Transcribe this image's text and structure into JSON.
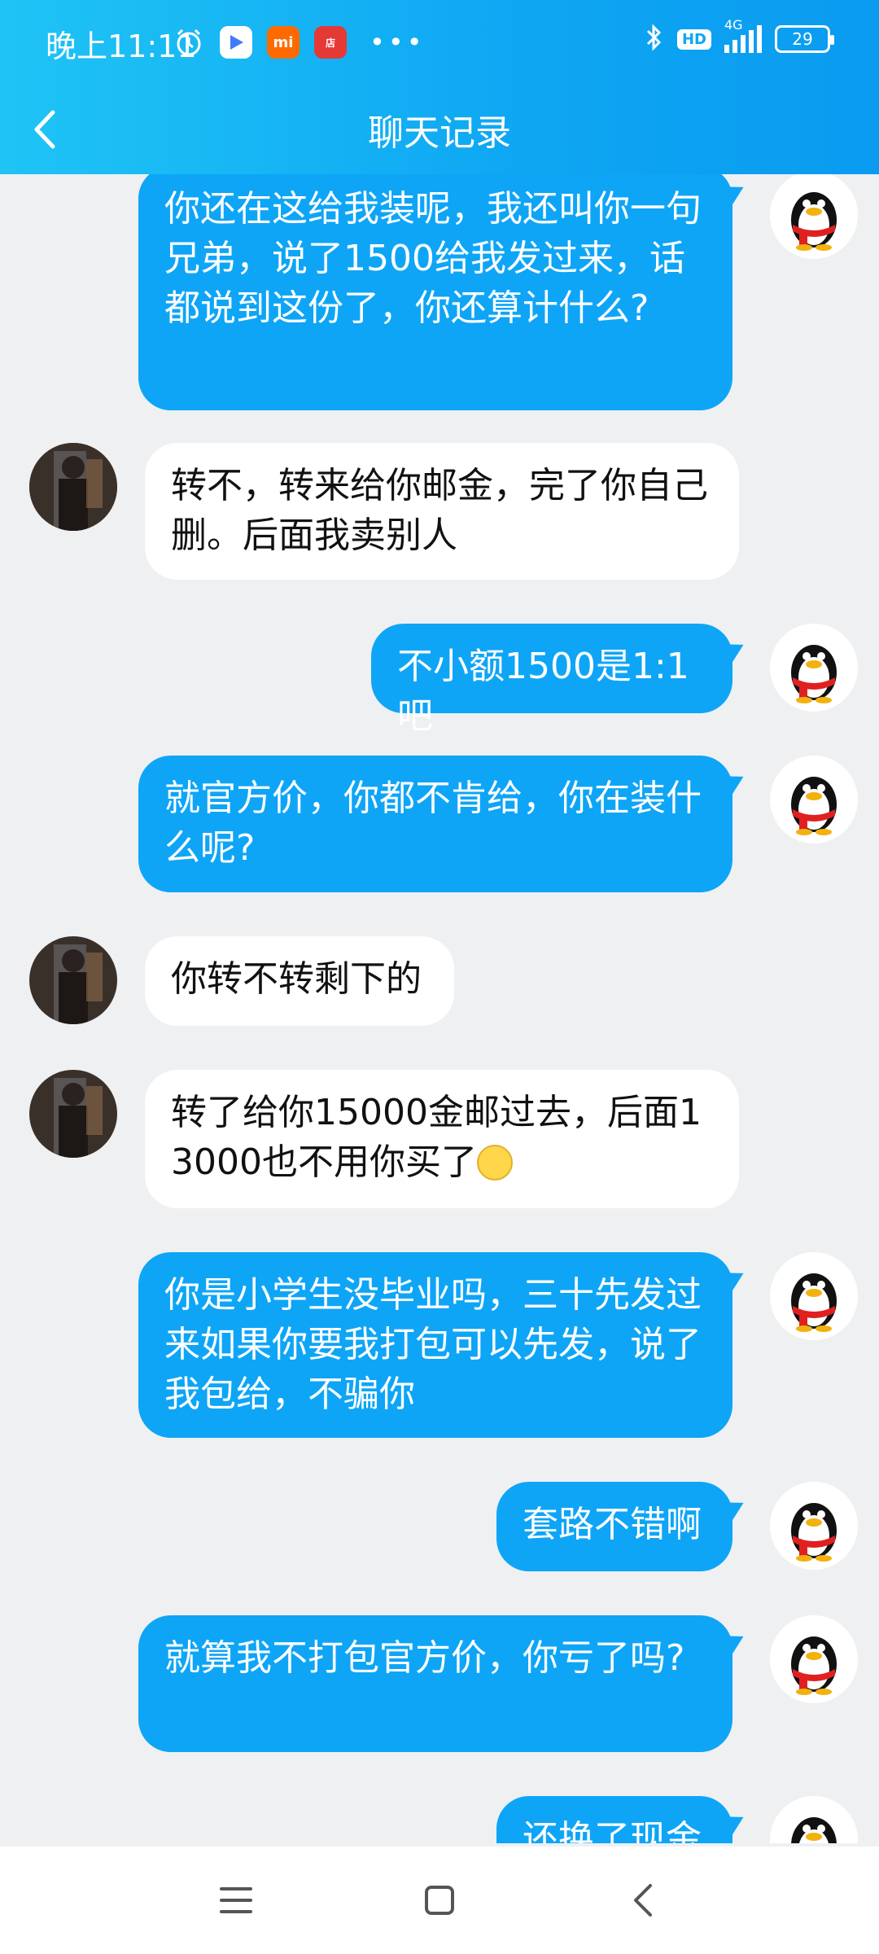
{
  "status": {
    "time": "晚上11:11",
    "network": "4G",
    "hd": "HD",
    "battery": "29"
  },
  "header": {
    "title": "聊天记录"
  },
  "messages": [
    {
      "side": "right",
      "text": "你还在这给我装呢，我还叫你一句兄弟，说了1500给我发过来，话都说到这份了，你还算计什么?"
    },
    {
      "side": "left",
      "text": "转不，转来给你邮金，完了你自己删。后面我卖别人"
    },
    {
      "side": "right",
      "text": "不小额1500是1:1吧"
    },
    {
      "side": "right",
      "text": "就官方价，你都不肯给，你在装什么呢?"
    },
    {
      "side": "left",
      "text": "你转不转剩下的"
    },
    {
      "side": "left",
      "text": "转了给你15000金邮过去，后面13000也不用你买了"
    },
    {
      "side": "right",
      "text": "你是小学生没毕业吗，三十先发过来如果你要我打包可以先发，说了我包给，不骗你"
    },
    {
      "side": "right",
      "text": "套路不错啊"
    },
    {
      "side": "right",
      "text": "就算我不打包官方价，你亏了吗?"
    },
    {
      "side": "right",
      "text": "还换了现金"
    }
  ],
  "colors": {
    "header_gradient_start": "#1fc4f5",
    "header_gradient_end": "#0a9bf0",
    "outgoing_bubble": "#0ea5f7",
    "incoming_bubble": "#ffffff",
    "background": "#eff0f2"
  }
}
